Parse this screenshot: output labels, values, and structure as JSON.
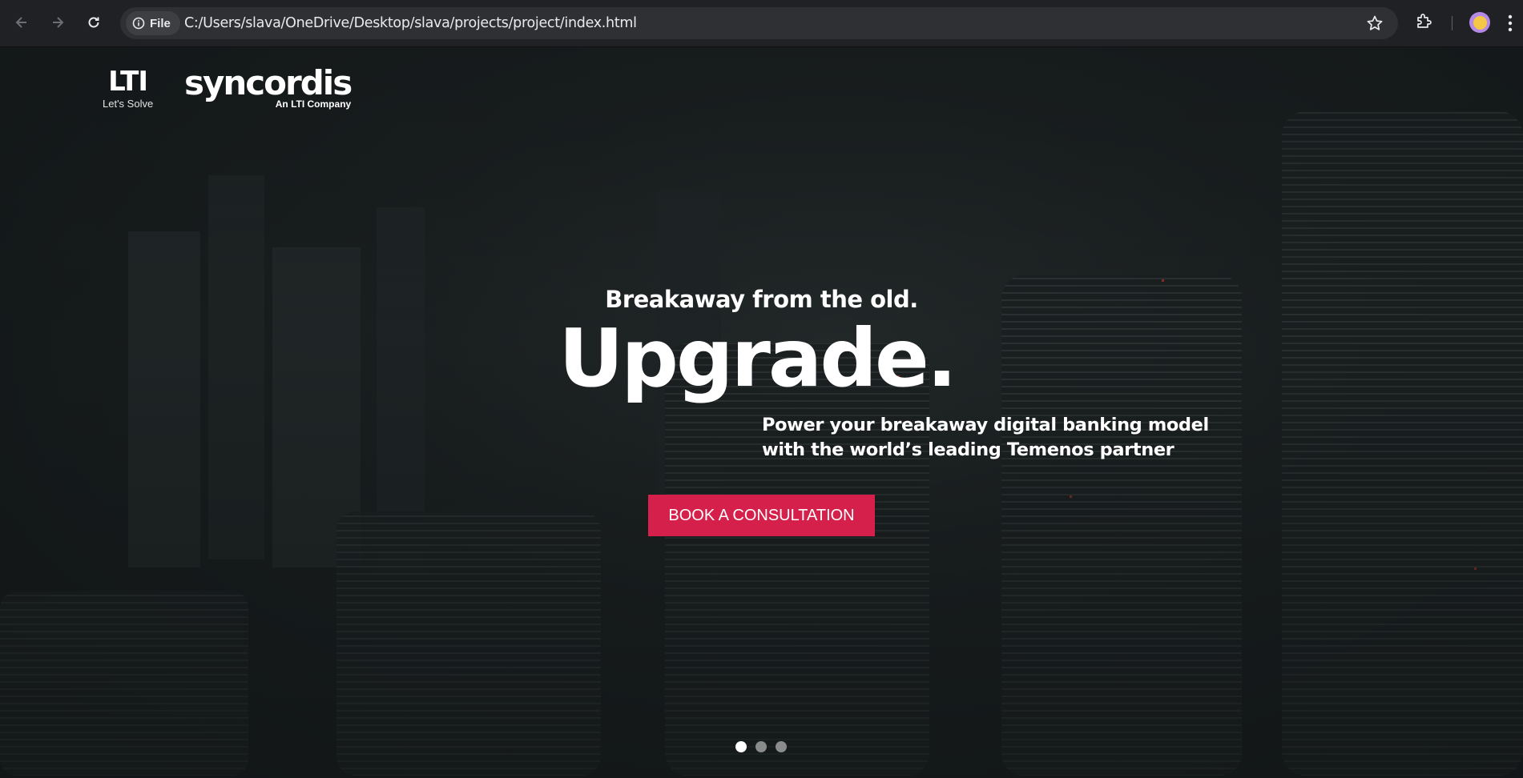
{
  "browser": {
    "back_icon": "arrow-left-icon",
    "forward_icon": "arrow-right-icon",
    "reload_icon": "reload-icon",
    "site_info_label": "File",
    "url": "C:/Users/slava/OneDrive/Desktop/slava/projects/project/index.html",
    "bookmark_icon": "star-icon",
    "extensions_icon": "puzzle-icon",
    "profile_icon": "avatar-icon",
    "menu_icon": "kebab-menu-icon"
  },
  "header": {
    "lti_mark": "LTI",
    "lti_tagline": "Let's Solve",
    "brand_name": "syncordis",
    "brand_sub": "An LTI Company"
  },
  "hero": {
    "tagline": "Breakaway from the old.",
    "headline": "Upgrade.",
    "subhead_line1": "Power your breakaway digital banking model",
    "subhead_line2": "with the world’s leading Temenos partner",
    "cta_label": "BOOK A CONSULTATION",
    "slides": 3,
    "active_slide": 1
  },
  "colors": {
    "cta": "#d4204b",
    "chrome_bg": "#202124",
    "omnibox_bg": "#2f3033"
  }
}
